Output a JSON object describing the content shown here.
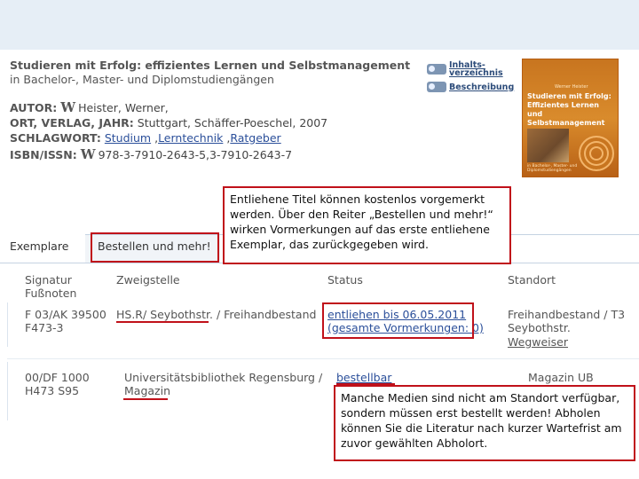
{
  "record": {
    "title": "Studieren mit Erfolg: effizientes Lernen und Selbstmanagement",
    "subtitle": "in Bachelor-, Master- und Diplomstudiengängen",
    "author_label": "AUTOR:",
    "author_value": "Heister, Werner,",
    "publisher_label": "ORT, VERLAG, JAHR:",
    "publisher_value": "Stuttgart, Schäffer-Poeschel, 2007",
    "keyword_label": "SCHLAGWORT:",
    "keywords": [
      "Studium",
      "Lerntechnik",
      "Ratgeber"
    ],
    "keyword_sep": " ,",
    "isbn_label": "ISBN/ISSN:",
    "isbn_value": "978-3-7910-2643-5,3-7910-2643-7"
  },
  "side_buttons": {
    "contents": "Inhalts-\nverzeichnis",
    "description": "Beschreibung"
  },
  "cover": {
    "author": "Werner Heister",
    "title": "Studieren mit Erfolg: Effizientes Lernen und Selbstmanagement",
    "subtitle": "in Bachelor-, Master- und Diplomstudiengängen"
  },
  "tabs": {
    "copies": "Exemplare",
    "order": "Bestellen und mehr!"
  },
  "table": {
    "headers": {
      "signature": "Signatur\nFußnoten",
      "branch": "Zweigstelle",
      "status": "Status",
      "location": "Standort"
    },
    "rows": [
      {
        "signature": "F 03/AK 39500\nF473-3",
        "branch": "HS.R/ Seybothstr. / Freihandbestand",
        "status": "entliehen bis 06.05.2011\n(gesamte Vormerkungen: 0)",
        "location": "Freihandbestand / T3\nSeybothstr.",
        "location_link": "Wegweiser"
      },
      {
        "signature": "00/DF 1000\nH473 S95",
        "branch": "Universitätsbibliothek Regensburg /\nMagazin",
        "status": "bestellbar",
        "location": "Magazin UB"
      }
    ]
  },
  "callouts": {
    "reserve": "Entliehene Titel können kostenlos vorgemerkt werden. Über den Reiter „Bestellen und mehr!“ wirken Vormerkungen auf das erste entliehene Exemplar, das zurückgegeben wird.",
    "order": "Manche Medien sind nicht am Standort verfügbar, sondern müssen erst bestellt werden! Abholen können Sie die Literatur nach kurzer Wartefrist am zuvor gewählten Abholort."
  },
  "colors": {
    "accent_red": "#c0111a",
    "link_blue": "#2b4f9a",
    "cover_orange": "#d98b2c"
  }
}
